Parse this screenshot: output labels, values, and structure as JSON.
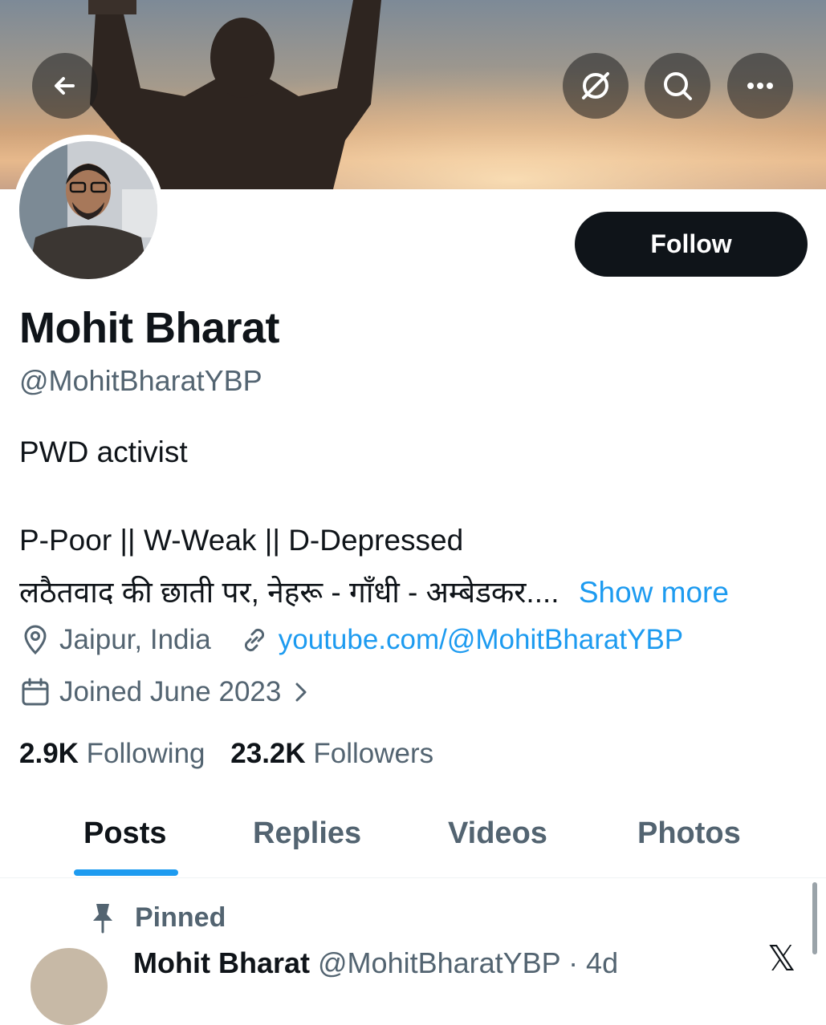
{
  "header": {
    "icons": [
      "back-arrow-icon",
      "explore-icon",
      "search-icon",
      "more-icon"
    ]
  },
  "profile": {
    "name": "Mohit Bharat",
    "handle": "@MohitBharatYBP",
    "follow_label": "Follow",
    "bio": {
      "line1": "PWD activist",
      "line2": "P-Poor || W-Weak || D-Depressed",
      "line3": "लठैतवाद की छाती पर, नेहरू - गाँधी - अम्बेडकर....",
      "show_more": "Show more"
    },
    "location": "Jaipur, India",
    "website": "youtube.com/@MohitBharatYBP",
    "joined": "Joined June 2023",
    "following_count": "2.9K",
    "following_label": "Following",
    "followers_count": "23.2K",
    "followers_label": "Followers"
  },
  "tabs": [
    {
      "label": "Posts",
      "active": true
    },
    {
      "label": "Replies",
      "active": false
    },
    {
      "label": "Videos",
      "active": false
    },
    {
      "label": "Photos",
      "active": false
    }
  ],
  "feed": {
    "pinned_label": "Pinned",
    "post": {
      "author": "Mohit Bharat",
      "handle": "@MohitBharatYBP",
      "age": "· 4d"
    }
  },
  "colors": {
    "accent": "#1d9bf0",
    "text_primary": "#0f1419",
    "text_secondary": "#536471",
    "button_dark": "#0f1419"
  }
}
